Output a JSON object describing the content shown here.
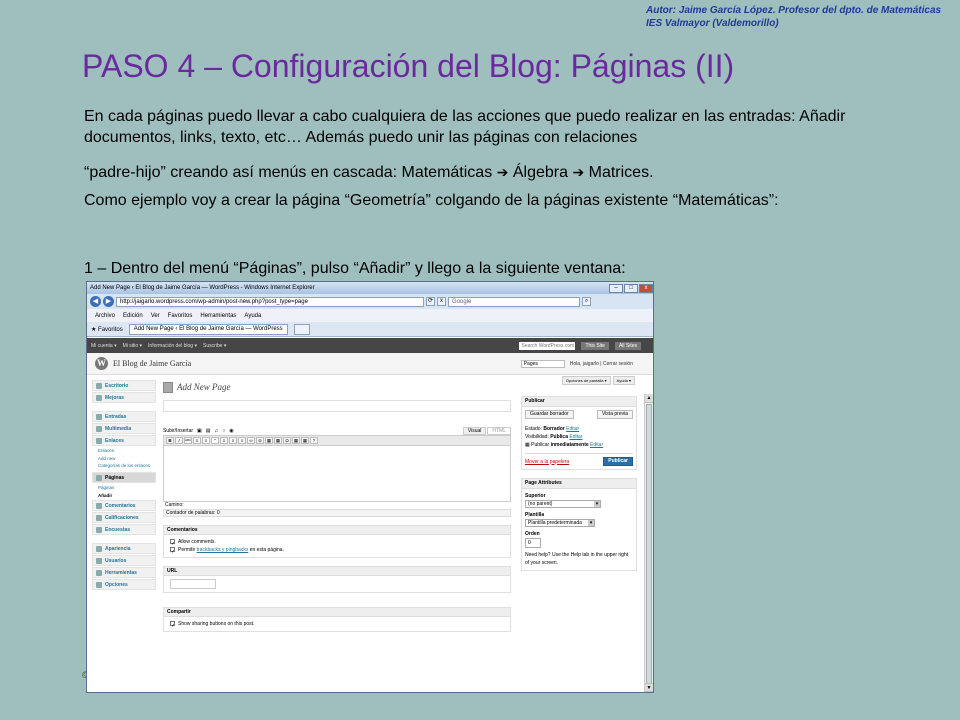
{
  "author": {
    "line1": "Autor: Jaime García López. Profesor del dpto. de Matemáticas",
    "line2": "IES Valmayor (Valdemorillo)"
  },
  "slide_title": "PASO 4 – Configuración del Blog: Páginas (II)",
  "paragraphs": {
    "p1": "En cada páginas puedo llevar a cabo cualquiera de las acciones que puedo realizar en las entradas: Añadir documentos, links, texto, etc… Además puedo unir las páginas con relaciones",
    "p2_a": "“padre-hijo” creando así menús en cascada: Matemáticas ",
    "p2_b": " Álgebra ",
    "p2_c": " Matrices.",
    "p3": "Como ejemplo voy a crear la página “Geometría” colgando de la páginas existente “Matemáticas”:",
    "p4": "1 – Dentro del menú “Páginas”, pulso “Añadir” y llego a la siguiente ventana:",
    "arrow": "➔"
  },
  "copyright": "©",
  "browser": {
    "title": "Add New Page ‹ El Blog de Jaime García — WordPress - Windows Internet Explorer",
    "url": "http://jaigarlo.wordpress.com/wp-admin/post-new.php?post_type=page",
    "search_placeholder": "Google",
    "menu": [
      "Archivo",
      "Edición",
      "Ver",
      "Favoritos",
      "Herramientas",
      "Ayuda"
    ],
    "favorites": "Favoritos",
    "tab": "Add New Page ‹ El Blog de Jaime García — WordPress"
  },
  "wp": {
    "adminbar": [
      "Mi cuenta ▾",
      "Mi sitio ▾",
      "Información del blog ▾",
      "Suscribe ▾"
    ],
    "adminbar_search": "Search WordPress.com",
    "this_site": "This Site",
    "all_sites": "All Sites",
    "blog_name": "El Blog de Jaime García",
    "pages_select": "Pages",
    "howdy": "Hola, jaigarlo | Cerrar sesión",
    "screen_options": "Opciones de pantalla ▾",
    "help": "Ayuda ▾",
    "sidebar": {
      "escritorio": "Escritorio",
      "mejoras": "Mejoras",
      "entradas": "Entradas",
      "multimedia": "Multimedia",
      "enlaces": "Enlaces",
      "enlaces_sub": [
        "Enlaces",
        "Add new",
        "Categorías de los enlaces"
      ],
      "paginas": "Páginas",
      "paginas_sub": [
        "Páginas",
        "Añadir"
      ],
      "comentarios": "Comentarios",
      "calificaciones": "Calificaciones",
      "encuestas": "Encuestas",
      "apariencia": "Apariencia",
      "usuarios": "Usuarios",
      "herramientas": "Herramientas",
      "opciones": "Opciones"
    },
    "heading": "Add New Page",
    "upload_label": "Subir/Insertar",
    "tab_visual": "Visual",
    "tab_html": "HTML",
    "toolbar_buttons": [
      "B",
      "I",
      "ABC",
      "≡",
      "≡",
      "“",
      "≡",
      "≡",
      "≡",
      "∞",
      "⊘",
      "▦",
      "▦",
      "Ω",
      "▦",
      "▦",
      "?"
    ],
    "path": "Camino:",
    "word_count": "Contador de palabras: 0",
    "comments_head": "Comentarios",
    "allow_comments": "Allow comments.",
    "trackbacks_prefix": "Permitir ",
    "trackbacks_link": "trackbacks y pingbacks",
    "trackbacks_suffix": " en esta página.",
    "url_head": "URL",
    "share_head": "Compartir",
    "share_text": "Show sharing buttons on this post.",
    "publish": {
      "head": "Publicar",
      "save_draft": "Guardar borrador",
      "preview": "Vista previa",
      "status_label": "Estado: ",
      "status_value": "Borrador",
      "visibility_label": "Visibilidad: ",
      "visibility_value": "Pública",
      "publish_label": "Publicar ",
      "publish_value": "inmediatamente",
      "edit": "Editar",
      "trash": "Mover a la papelera",
      "publish_btn": "Publicar"
    },
    "attributes": {
      "head": "Page Attributes",
      "parent_label": "Superior",
      "parent_value": "(no parent)",
      "template_label": "Plantilla",
      "template_value": "Plantilla predeterminada",
      "order_label": "Orden",
      "order_value": "0",
      "help_text": "Need help? Use the Help tab in the upper right of your screen."
    }
  }
}
